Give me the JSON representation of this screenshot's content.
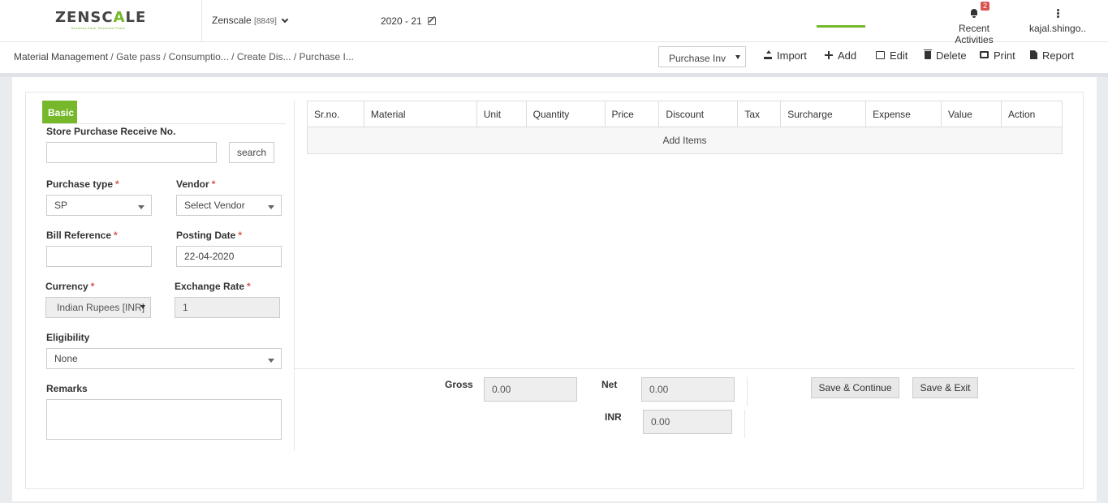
{
  "header": {
    "logo_text_prefix": "ZENSC",
    "logo_text_accent": "A",
    "logo_text_suffix": "LE",
    "logo_tagline": "Business Ease. Business Peace.",
    "company_name": "Zenscale",
    "company_code": "[8849]",
    "fiscal_year": "2020 - 21",
    "recent_activities_label": "Recent Activities",
    "notification_count": "2",
    "user_name": "kajal.shingo.."
  },
  "toolbar": {
    "breadcrumb": {
      "root": "Material Management",
      "items": [
        " / Gate pass",
        " / Consumptio...",
        " / Create Dis...",
        " / Purchase I..."
      ]
    },
    "doc_type_selected": "Purchase Invoice",
    "import_label": "Import",
    "add_label": "Add",
    "edit_label": "Edit",
    "delete_label": "Delete",
    "print_label": "Print",
    "report_label": "Report",
    "accent_color": "#76b82a"
  },
  "form": {
    "tab_basic": "Basic",
    "store_receive_label": "Store Purchase Receive No.",
    "store_receive_value": "",
    "search_button": "search",
    "purchase_type_label": "Purchase type",
    "purchase_type_value": "SP",
    "vendor_label": "Vendor",
    "vendor_value": "Select Vendor",
    "bill_reference_label": "Bill Reference",
    "bill_reference_value": "",
    "posting_date_label": "Posting Date",
    "posting_date_value": "22-04-2020",
    "currency_label": "Currency",
    "currency_value": "Indian Rupees [INR]",
    "exchange_rate_label": "Exchange Rate",
    "exchange_rate_value": "1",
    "eligibility_label": "Eligibility",
    "eligibility_value": "None",
    "remarks_label": "Remarks",
    "remarks_value": "",
    "required_mark": "*"
  },
  "items_table": {
    "columns": [
      "Sr.no.",
      "Material",
      "Unit",
      "Quantity",
      "Price",
      "Discount",
      "Tax",
      "Surcharge",
      "Expense",
      "Value",
      "Action"
    ],
    "add_items_label": "Add Items"
  },
  "totals": {
    "gross_label": "Gross",
    "gross_value": "0.00",
    "net_label": "Net",
    "net_value": "0.00",
    "inr_label": "INR",
    "inr_value": "0.00",
    "save_continue_label": "Save & Continue",
    "save_exit_label": "Save & Exit"
  }
}
